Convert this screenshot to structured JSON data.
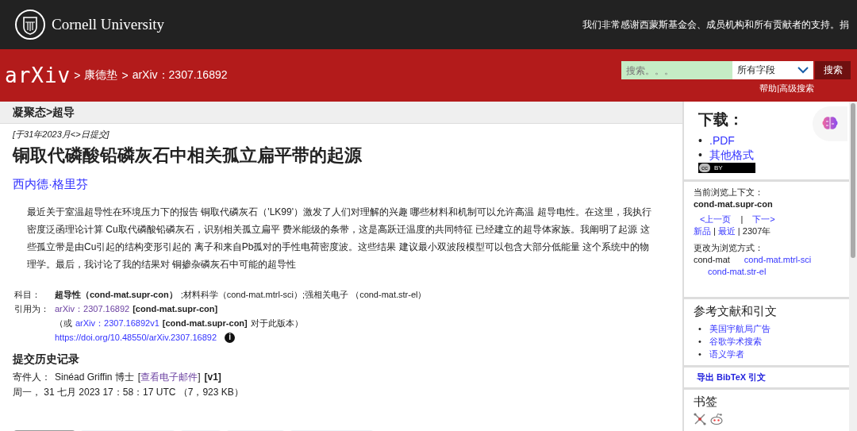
{
  "header": {
    "brand": "Cornell University",
    "thanks": "我们非常感谢西蒙斯基金会、成员机构和所有贡献者的支持。捐"
  },
  "nav": {
    "logo": "arXiv",
    "breadcrumbs": [
      ">",
      "康德垫",
      ">",
      "arXiv：2307.16892"
    ],
    "search": {
      "placeholder": "搜索。。。",
      "field": "所有字段",
      "button": "搜索"
    },
    "links": [
      "帮助",
      "|高级搜索"
    ]
  },
  "subheader": "凝聚态>超导",
  "paper": {
    "dateline": "[于31年2023月<>日提交]",
    "title": "铜取代磷酸铅磷灰石中相关孤立扁平带的起源",
    "author": "西内德·格里芬",
    "abstract": "最近关于室温超导性在环境压力下的报告 铜取代磷灰石（'LK99'）激发了人们对理解的兴趣 哪些材料和机制可以允许高温 超导电性。在这里，我执行密度泛函理论计算 Cu取代磷酸铅磷灰石，识别相关孤立扁平 费米能级的条带，这是高跃迁温度的共同特征 已经建立的超导体家族。我阐明了起源 这些孤立带是由Cu引起的结构变形引起的 离子和来自Pb孤对的手性电荷密度波。这些结果 建议最小双波段模型可以包含大部分低能量 这个系统中的物理学。最后，我讨论了我的结果对 铜掺杂磷灰石中可能的超导性",
    "meta": [
      {
        "label": "科目：",
        "parts": [
          {
            "kind": "bold",
            "text": "超导性（cond-mat.supr-con）"
          },
          {
            "kind": "plain",
            "text": ";材料科学（cond-mat.mtrl-sci）;强相关电子 （cond-mat.str-el）"
          }
        ]
      },
      {
        "label": "引用为：",
        "parts": [
          {
            "kind": "visited",
            "text": "arXiv：2307.16892"
          },
          {
            "kind": "bold",
            "text": "[cond-mat.supr-con]"
          }
        ]
      },
      {
        "parts": [
          {
            "kind": "plain",
            "text": "（或"
          },
          {
            "kind": "link",
            "text": "arXiv：2307.16892v1"
          },
          {
            "kind": "bold",
            "text": "[cond-mat.supr-con]"
          },
          {
            "kind": "plain",
            "text": "对于此版本）"
          }
        ]
      },
      {
        "parts": [
          {
            "kind": "link",
            "text": "https://doi.org/10.48550/arXiv.2307.16892"
          },
          {
            "kind": "info",
            "text": "i"
          }
        ]
      }
    ]
  },
  "history": {
    "heading": "提交历史记录",
    "sender_label": "寄件人：",
    "sender": "Sinéad Griffin 博士",
    "email_open": "[",
    "email": "查看电子邮件",
    "email_close": "]",
    "version": "[v1]",
    "date": "周一， 31 七月 2023 17：58：17 UTC （7，923 KB）"
  },
  "tabs": [
    {
      "selected": true
    },
    {
      "selected": false
    },
    {
      "selected": false
    },
    {
      "selected": false
    },
    {
      "selected": false
    }
  ],
  "sidebar": {
    "download": {
      "heading": "下载：",
      "links": [
        {
          "bullet": "•",
          "text": ".PDF"
        },
        {
          "bullet": "•",
          "text": "其他格式"
        }
      ],
      "license": [
        "cc",
        "BY"
      ]
    },
    "browse": {
      "label": "当前浏览上下文：",
      "context": "cond-mat.supr-con",
      "prev": "<上一页",
      "sep": "|",
      "next": "下一>",
      "links": [
        {
          "kind": "link",
          "text": "新品"
        },
        {
          "kind": "plain",
          "text": "|"
        },
        {
          "kind": "link",
          "text": "最近"
        },
        {
          "kind": "plain",
          "text": "| 2307年"
        }
      ],
      "change_label": "更改为浏览方式：",
      "change_plain": "cond-mat",
      "change_links": [
        "cond-mat.mtrl-sci",
        "cond-mat.str-el"
      ]
    },
    "refs": {
      "heading": "参考文献和引文",
      "links": [
        {
          "bullet": "•",
          "text": "美国宇航局广告"
        },
        {
          "bullet": "•",
          "text": "谷歌学术搜索"
        },
        {
          "bullet": "•",
          "text": "语义学者"
        }
      ]
    },
    "bibtex": "导出 BibTeX 引文",
    "bookmarks": {
      "heading": "书签"
    }
  }
}
